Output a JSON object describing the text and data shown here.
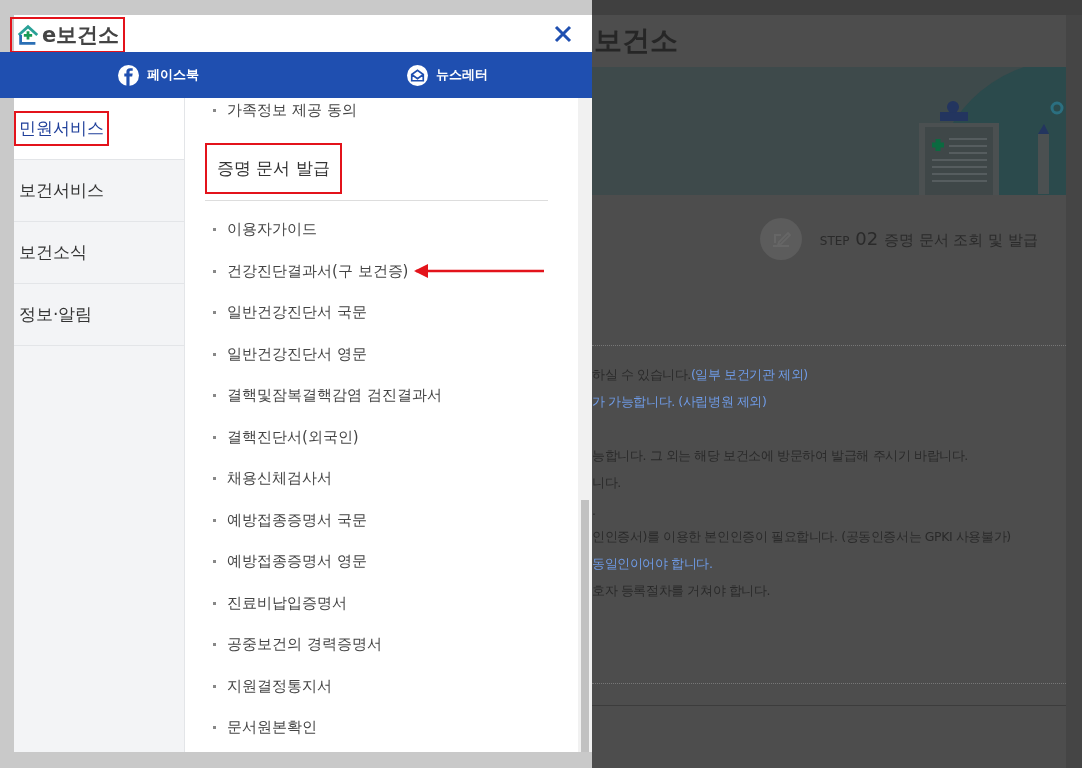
{
  "menu_panel": {
    "logo": {
      "text": "e보건소",
      "highlighted": true
    },
    "social_links": [
      {
        "kind": "facebook",
        "label": "페이스북"
      },
      {
        "kind": "newsletter",
        "label": "뉴스레터"
      }
    ],
    "categories": [
      {
        "label": "민원서비스",
        "selected": true,
        "highlighted": true
      },
      {
        "label": "보건서비스",
        "selected": false,
        "highlighted": false
      },
      {
        "label": "보건소식",
        "selected": false,
        "highlighted": false
      },
      {
        "label": "정보·알림",
        "selected": false,
        "highlighted": false
      }
    ],
    "previous_item": "가족정보 제공 동의",
    "section": {
      "title": "증명 문서 발급",
      "highlighted": true,
      "items": [
        {
          "label": "이용자가이드",
          "pointed": false
        },
        {
          "label": "건강진단결과서(구 보건증)",
          "pointed": true
        },
        {
          "label": "일반건강진단서 국문",
          "pointed": false
        },
        {
          "label": "일반건강진단서 영문",
          "pointed": false
        },
        {
          "label": "결핵및잠복결핵감염 검진결과서",
          "pointed": false
        },
        {
          "label": "결핵진단서(외국인)",
          "pointed": false
        },
        {
          "label": "채용신체검사서",
          "pointed": false
        },
        {
          "label": "예방접종증명서 국문",
          "pointed": false
        },
        {
          "label": "예방접종증명서 영문",
          "pointed": false
        },
        {
          "label": "진료비납입증명서",
          "pointed": false
        },
        {
          "label": "공중보건의 경력증명서",
          "pointed": false
        },
        {
          "label": "지원결정통지서",
          "pointed": false
        },
        {
          "label": "문서원본확인",
          "pointed": false
        }
      ]
    }
  },
  "background_page": {
    "site_title": "보건소",
    "step": {
      "prefix": "STEP",
      "number": "02",
      "title": "증명 문서 조회 및 발급"
    },
    "notes": [
      [
        {
          "text": "하실 수 있습니다.",
          "emphasis": false
        },
        {
          "text": "(일부 보건기관 제외)",
          "emphasis": true
        }
      ],
      [
        {
          "text": "가 가능합니다. (사립병원 제외)",
          "emphasis": true
        }
      ],
      [
        {
          "text": "능합니다. 그 외는 해당 보건소에 방문하여 발급해 주시기 바랍니다.",
          "emphasis": false
        }
      ],
      [
        {
          "text": "니다.",
          "emphasis": false
        }
      ],
      [
        {
          "text": ".",
          "emphasis": false
        }
      ],
      [
        {
          "text": "인인증서)를 이용한 본인인증이 필요합니다. (공동인증서는 GPKI 사용불가)",
          "emphasis": false
        }
      ],
      [
        {
          "text": "동일인이어야 합니다.",
          "emphasis": true
        }
      ],
      [
        {
          "text": "호자 등록절차를 거쳐야 합니다.",
          "emphasis": false
        }
      ]
    ]
  }
}
